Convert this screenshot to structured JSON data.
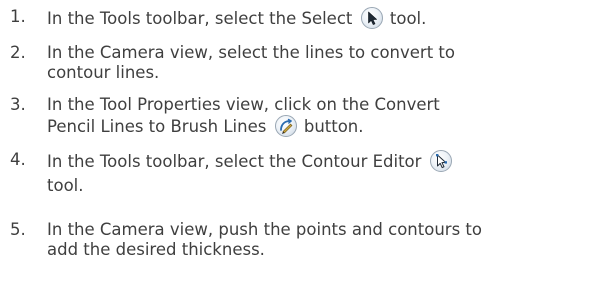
{
  "steps": [
    {
      "number": "1.",
      "line1_a": "In the Tools toolbar, select the Select",
      "line1_icon": "select-tool-icon",
      "line1_b": "tool."
    },
    {
      "number": "2.",
      "line1": "In the Camera view, select the lines to convert to",
      "line2": "contour lines."
    },
    {
      "number": "3.",
      "line1": "In the Tool Properties view, click on the Convert",
      "line2_a": "Pencil Lines to Brush Lines",
      "line2_icon": "convert-pencil-to-brush-icon",
      "line2_b": "button."
    },
    {
      "number": "4.",
      "line1_a": "In the Tools toolbar, select the Contour Editor",
      "line1_icon": "contour-editor-tool-icon",
      "line2": "tool."
    },
    {
      "number": "5.",
      "line1": "In the Camera view, push the points and contours to",
      "line2": "add the desired thickness."
    }
  ]
}
